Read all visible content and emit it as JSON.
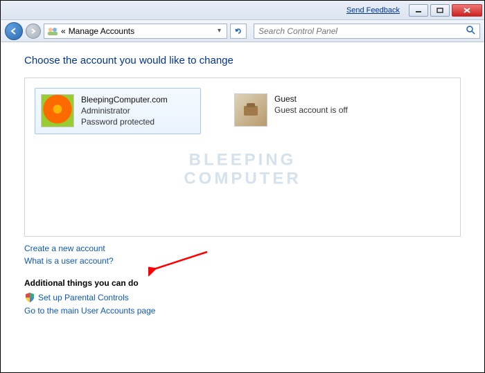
{
  "titlebar": {
    "feedback": "Send Feedback"
  },
  "nav": {
    "crumb_prefix": "«",
    "crumb": "Manage Accounts",
    "search_placeholder": "Search Control Panel"
  },
  "heading": "Choose the account you would like to change",
  "accounts": [
    {
      "name": "BleepingComputer.com",
      "role": "Administrator",
      "status": "Password protected"
    },
    {
      "name": "Guest",
      "role": "Guest account is off",
      "status": ""
    }
  ],
  "watermark_line1": "BLEEPING",
  "watermark_line2": "COMPUTER",
  "links": {
    "create": "Create a new account",
    "whatis": "What is a user account?"
  },
  "additional": {
    "heading": "Additional things you can do",
    "parental": "Set up Parental Controls",
    "mainpage": "Go to the main User Accounts page"
  }
}
